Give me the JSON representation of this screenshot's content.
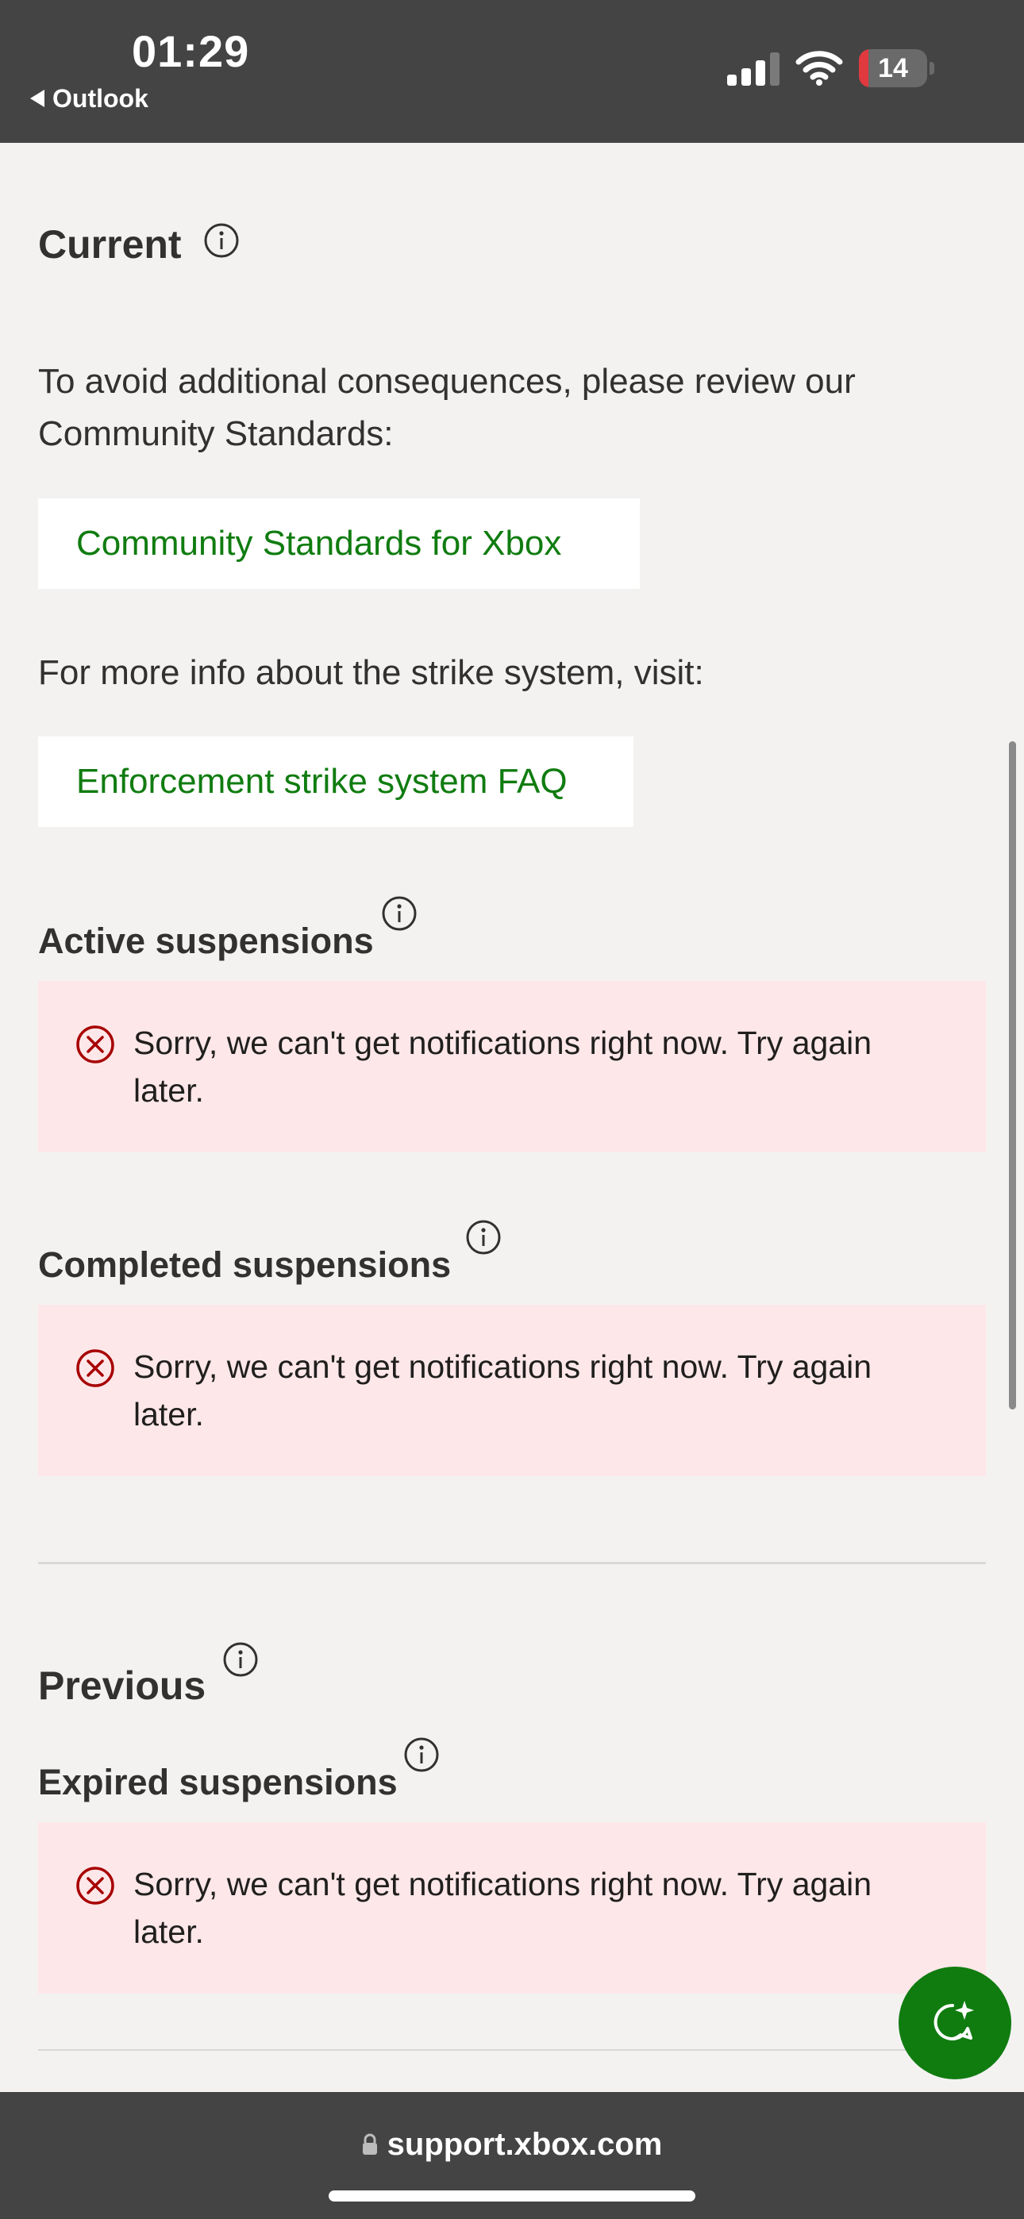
{
  "status_bar": {
    "time": "01:29",
    "back_label": "Outlook",
    "battery_level": "14"
  },
  "content": {
    "current_heading": "Current",
    "intro_text": "To avoid additional consequences, please review our Community Standards:",
    "community_standards_link": "Community Standards for Xbox",
    "strike_info_text": "For more info about the strike system, visit:",
    "strike_faq_link": "Enforcement strike system FAQ",
    "active_suspensions_heading": "Active suspensions",
    "active_suspensions_error": "Sorry, we can't get notifications right now. Try again later.",
    "completed_suspensions_heading": "Completed suspensions",
    "completed_suspensions_error": "Sorry, we can't get notifications right now. Try again later.",
    "previous_heading": "Previous",
    "expired_suspensions_heading": "Expired suspensions",
    "expired_suspensions_error": "Sorry, we can't get notifications right now. Try again later."
  },
  "url_bar": {
    "domain": "support.xbox.com"
  },
  "icons": {
    "info": "info-icon",
    "error": "error-circle-x-icon",
    "chat": "chat-sparkle-icon",
    "lock": "lock-icon"
  },
  "colors": {
    "link_green": "#107c10",
    "error_background": "#fde7e9",
    "error_red": "#a80000",
    "page_background": "#f3f2f1",
    "chrome_background": "#444444",
    "battery_low": "#e0393e"
  }
}
